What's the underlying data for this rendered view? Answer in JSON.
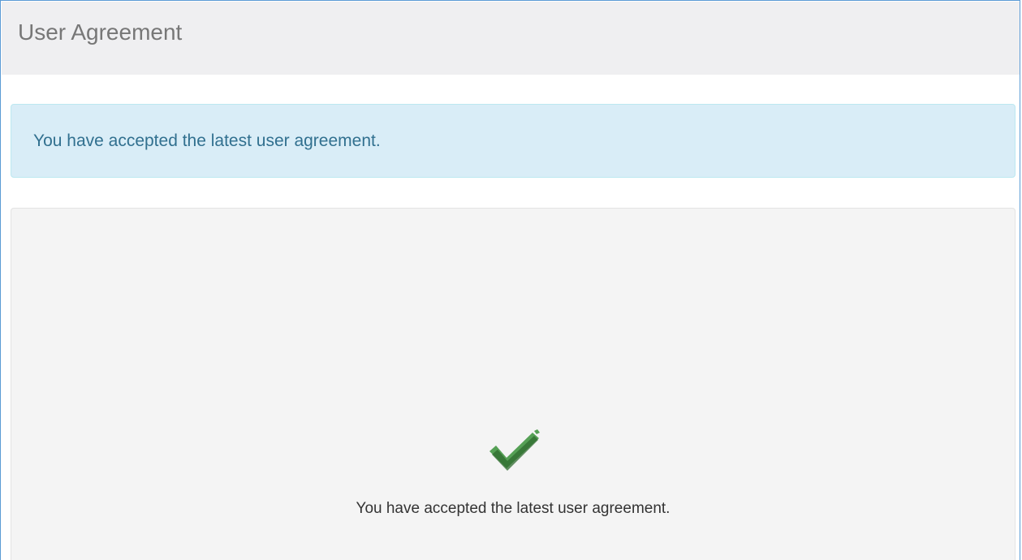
{
  "header": {
    "title": "User Agreement"
  },
  "alert": {
    "message": "You have accepted the latest user agreement."
  },
  "panel": {
    "icon": "checkmark-icon",
    "icon_color": "#3a7d3a",
    "message": "You have accepted the latest user agreement."
  },
  "colors": {
    "header_bg": "#efeff1",
    "alert_bg": "#d9edf7",
    "alert_text": "#31708f",
    "panel_bg": "#f4f4f4",
    "frame_border": "#5b9bd5"
  }
}
